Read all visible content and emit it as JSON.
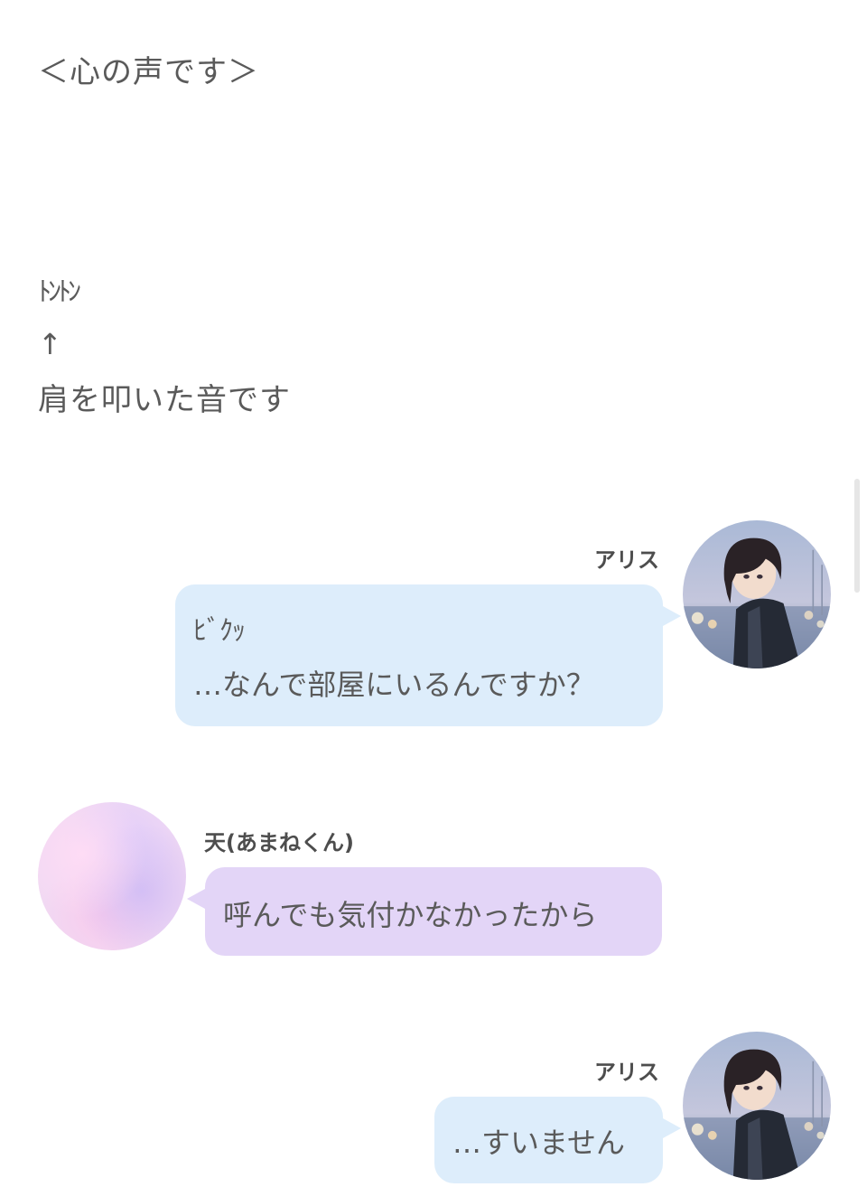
{
  "story": {
    "heading": "＜心の声です＞",
    "sfx": "ﾄﾝﾄﾝ",
    "arrow": "↑",
    "note": "肩を叩いた音です"
  },
  "messages": [
    {
      "speaker": "アリス",
      "side": "right",
      "avatar": "anime-girl-avatar",
      "lines": [
        "ﾋﾞｸｯ",
        "…なんで部屋にいるんですか？"
      ]
    },
    {
      "speaker": "天(あまねくん)",
      "side": "left",
      "avatar": "pastel-avatar",
      "lines": [
        "呼んでも気付かなかったから"
      ]
    },
    {
      "speaker": "アリス",
      "side": "right",
      "avatar": "anime-girl-avatar",
      "lines": [
        "…すいません"
      ]
    }
  ],
  "colors": {
    "right_bubble": "#ddedfb",
    "left_bubble": "#e3d5f7",
    "text": "#5a5a5a"
  }
}
